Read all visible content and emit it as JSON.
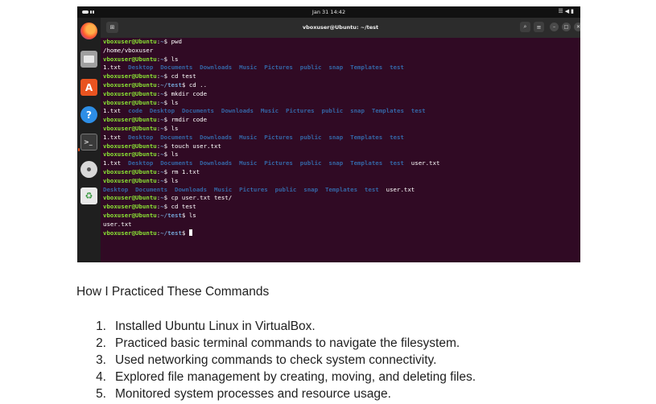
{
  "screenshot": {
    "topbar": {
      "clock": "Jan 31  14:42",
      "tray_icons": [
        "network-icon",
        "volume-icon",
        "battery-icon"
      ]
    },
    "dock": [
      "firefox",
      "files",
      "app-center",
      "help",
      "terminal",
      "dvd",
      "trash"
    ],
    "window": {
      "title": "vboxuser@Ubuntu: ~/test"
    },
    "terminal": {
      "user": "vboxuser@Ubuntu",
      "lines": [
        {
          "kind": "prompt",
          "path": "~",
          "cmd": "pwd"
        },
        {
          "kind": "out",
          "text": "/home/vboxuser"
        },
        {
          "kind": "prompt",
          "path": "~",
          "cmd": "ls"
        },
        {
          "kind": "ls",
          "items": [
            "1.txt",
            "Desktop",
            "Documents",
            "Downloads",
            "Music",
            "Pictures",
            "public",
            "snap",
            "Templates",
            "test"
          ]
        },
        {
          "kind": "prompt",
          "path": "~",
          "cmd": "cd test"
        },
        {
          "kind": "prompt",
          "path": "~/test",
          "cmd": "cd .."
        },
        {
          "kind": "prompt",
          "path": "~",
          "cmd": "mkdir code"
        },
        {
          "kind": "prompt",
          "path": "~",
          "cmd": "ls"
        },
        {
          "kind": "ls",
          "items": [
            "1.txt",
            "code",
            "Desktop",
            "Documents",
            "Downloads",
            "Music",
            "Pictures",
            "public",
            "snap",
            "Templates",
            "test"
          ]
        },
        {
          "kind": "prompt",
          "path": "~",
          "cmd": "rmdir code"
        },
        {
          "kind": "prompt",
          "path": "~",
          "cmd": "ls"
        },
        {
          "kind": "ls",
          "items": [
            "1.txt",
            "Desktop",
            "Documents",
            "Downloads",
            "Music",
            "Pictures",
            "public",
            "snap",
            "Templates",
            "test"
          ]
        },
        {
          "kind": "prompt",
          "path": "~",
          "cmd": "touch user.txt"
        },
        {
          "kind": "prompt",
          "path": "~",
          "cmd": "ls"
        },
        {
          "kind": "ls",
          "items": [
            "1.txt",
            "Desktop",
            "Documents",
            "Downloads",
            "Music",
            "Pictures",
            "public",
            "snap",
            "Templates",
            "test",
            "user.txt"
          ]
        },
        {
          "kind": "prompt",
          "path": "~",
          "cmd": "rm 1.txt"
        },
        {
          "kind": "prompt",
          "path": "~",
          "cmd": "ls"
        },
        {
          "kind": "ls",
          "items": [
            "Desktop",
            "Documents",
            "Downloads",
            "Music",
            "Pictures",
            "public",
            "snap",
            "Templates",
            "test",
            "user.txt"
          ]
        },
        {
          "kind": "prompt",
          "path": "~",
          "cmd": "cp user.txt test/"
        },
        {
          "kind": "prompt",
          "path": "~",
          "cmd": "cd test"
        },
        {
          "kind": "prompt",
          "path": "~/test",
          "cmd": "ls"
        },
        {
          "kind": "out",
          "text": "user.txt"
        },
        {
          "kind": "prompt",
          "path": "~/test",
          "cmd": "",
          "cursor": true
        }
      ]
    }
  },
  "article": {
    "heading": "How I Practiced These Commands",
    "steps": [
      {
        "num": "1.",
        "text": "Installed Ubuntu Linux in VirtualBox."
      },
      {
        "num": "2.",
        "text": "Practiced basic terminal commands to navigate the filesystem."
      },
      {
        "num": "3.",
        "text": "Used networking commands to check system connectivity."
      },
      {
        "num": "4.",
        "text": "Explored file management by creating, moving, and deleting files."
      },
      {
        "num": "5.",
        "text": "Monitored system processes and resource usage."
      }
    ]
  }
}
